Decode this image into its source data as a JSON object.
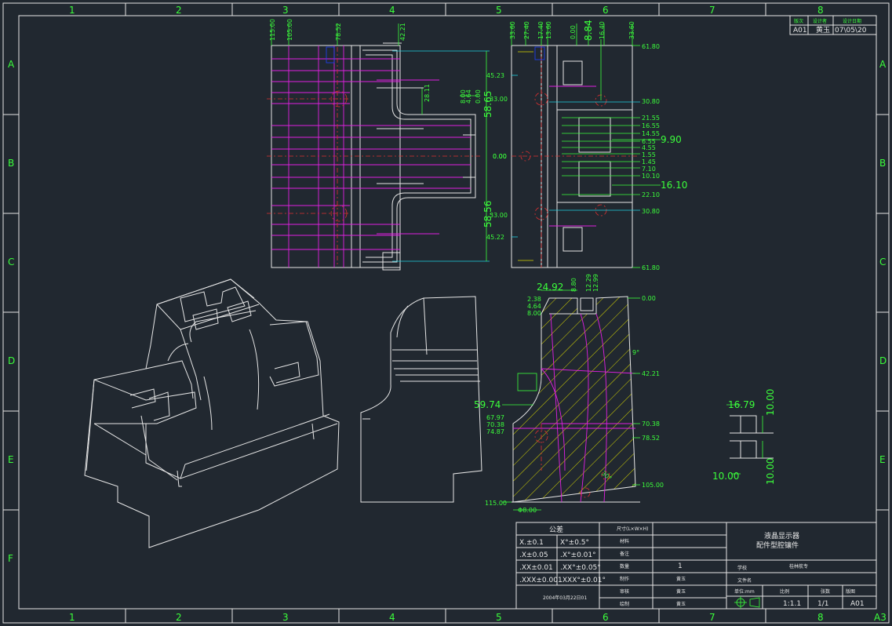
{
  "grid": {
    "columns": [
      "1",
      "2",
      "3",
      "4",
      "5",
      "6",
      "7",
      "8"
    ],
    "rows": [
      "A",
      "B",
      "C",
      "D",
      "E",
      "F"
    ],
    "sheet_size": "A3"
  },
  "revision_block": {
    "headers": [
      "版次",
      "设计者",
      "设计日期"
    ],
    "values": [
      "A01",
      "黄玉",
      "07\\05\\20"
    ]
  },
  "top_view_dims": {
    "vertical": [
      "115.00",
      "105.00",
      "78.52",
      "42.21",
      "28.11",
      "8.00",
      "4.64",
      "0.00",
      "58.65",
      "58.56"
    ],
    "labels_mid": [
      "0.00"
    ]
  },
  "right_view_dims": {
    "top": [
      "33.60",
      "27.40",
      "17.40",
      "13.60",
      "0.00",
      "8.84",
      "16.40",
      "33.60"
    ],
    "left": [
      "45.23",
      "33.00",
      "0.00",
      "33.00",
      "45.22"
    ],
    "right": [
      "61.80",
      "30.80",
      "21.55",
      "16.55",
      "14.55",
      "6.55",
      "4.55",
      "1.55",
      "1.45",
      "7.10",
      "10.10",
      "22.10",
      "30.80",
      "61.80"
    ],
    "big": [
      "9.90",
      "16.10"
    ]
  },
  "section_dims": {
    "top": [
      "24.92",
      "8.80",
      "12.29",
      "12.99"
    ],
    "left_small": [
      "2.38",
      "4.64",
      "8.00"
    ],
    "right": [
      "0.00",
      "42.21",
      "70.38",
      "78.52",
      "105.00"
    ],
    "angle": "9°",
    "left": [
      "59.74",
      "67.97",
      "70.38",
      "74.87"
    ],
    "bottom": [
      "115.00",
      "Φ8.00"
    ],
    "hatch_angle": "30°"
  },
  "detail_dims": [
    "16.79",
    "10.00",
    "10.00",
    "10.00"
  ],
  "title_block": {
    "tolerance_title": "公差",
    "tolerances": [
      [
        "X.±0.1",
        "X°±0.5°"
      ],
      [
        ".X±0.05",
        ".X°±0.01°"
      ],
      [
        ".XX±0.01",
        ".XX°±0.05°"
      ],
      [
        ".XXX±0.001",
        ".XXX°±0.01°"
      ]
    ],
    "date": "2004年03月22日01",
    "rows": [
      {
        "label": "尺寸(L×W×H)",
        "value": ""
      },
      {
        "label": "材料",
        "value": ""
      },
      {
        "label": "备注",
        "value": ""
      },
      {
        "label": "数量",
        "value": "1"
      },
      {
        "label": "制作",
        "value": "黄玉"
      },
      {
        "label": "审核",
        "value": "黄玉"
      },
      {
        "label": "绘制",
        "value": "黄玉"
      }
    ],
    "title_line1": "液晶显示器",
    "title_line2": "配件型腔镶件",
    "school_label": "学校",
    "school_value": "桂林航专",
    "file_label": "文件名",
    "unit_label": "单位:mm",
    "scale_label": "比例",
    "scale_value": "1:1.1",
    "sheets_label": "张数",
    "sheets_value": "1/1",
    "version_label": "版图",
    "version_value": "A01"
  }
}
